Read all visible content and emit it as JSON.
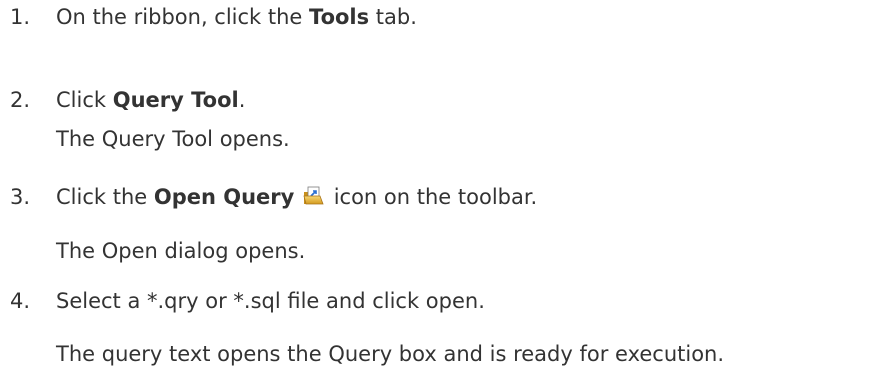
{
  "steps": [
    {
      "number": "1.",
      "pre": "On the ribbon, click the ",
      "bold": "Tools",
      "post": " tab."
    },
    {
      "number": "2.",
      "pre": "Click ",
      "bold": "Query Tool",
      "post": ".",
      "note": "The Query Tool opens."
    },
    {
      "number": "3.",
      "pre": "Click the ",
      "bold": "Open Query",
      "icon": "open-folder-icon",
      "post": " icon on the toolbar.",
      "note": "The Open dialog opens."
    },
    {
      "number": "4.",
      "text": "Select a *.qry or *.sql file and click open.",
      "note": "The query text opens the Query box and is ready for execution."
    }
  ]
}
